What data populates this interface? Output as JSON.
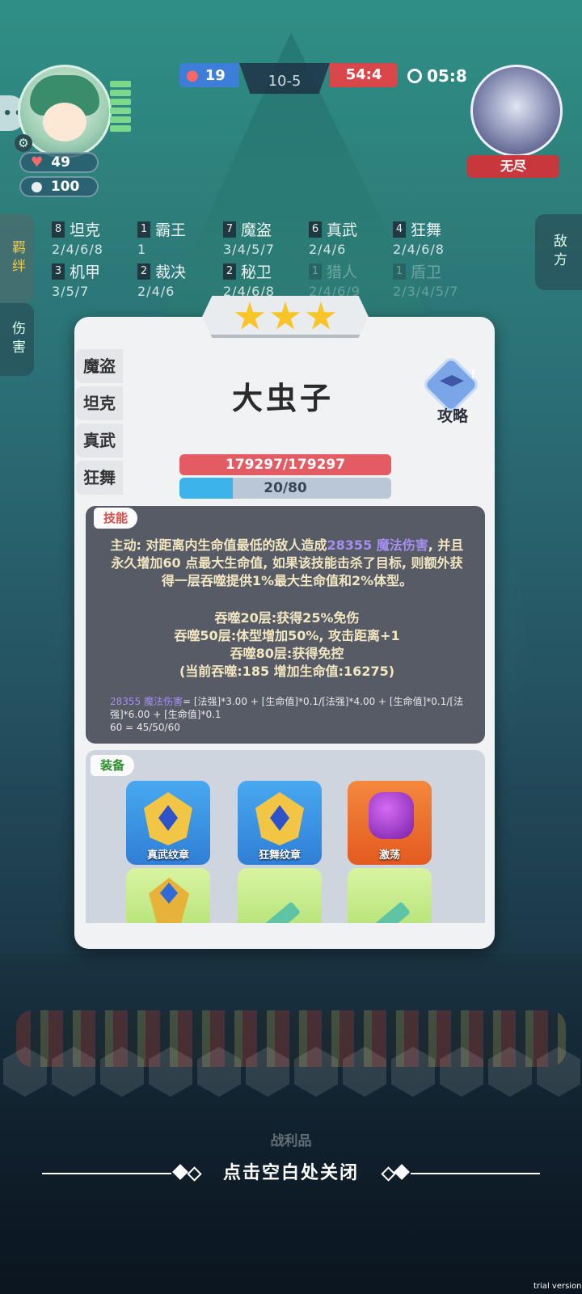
{
  "top": {
    "player_hp": "49",
    "player_coins": "100",
    "blue_score": "19",
    "round": "10-5",
    "red_score": "54:4",
    "timer": "05:8",
    "enemy_name": "无尽"
  },
  "left_tabs": {
    "bonds": "羁绊",
    "damage": "伤害"
  },
  "right_tab": "敌方",
  "synergies": [
    {
      "count": "8",
      "name": "坦克",
      "levels": "2/4/6/8"
    },
    {
      "count": "1",
      "name": "霸王",
      "levels": "1"
    },
    {
      "count": "7",
      "name": "魔盗",
      "levels": "3/4/5/7"
    },
    {
      "count": "6",
      "name": "真武",
      "levels": "2/4/6"
    },
    {
      "count": "4",
      "name": "狂舞",
      "levels": "2/4/6/8"
    },
    {
      "count": "3",
      "name": "机甲",
      "levels": "3/5/7"
    },
    {
      "count": "2",
      "name": "裁决",
      "levels": "2/4/6"
    },
    {
      "count": "2",
      "name": "秘卫",
      "levels": "2/4/6/8"
    },
    {
      "count": "1",
      "name": "猎人",
      "levels": "2/4/6/9"
    },
    {
      "count": "1",
      "name": "盾卫",
      "levels": "2/3/4/5/7"
    }
  ],
  "modal": {
    "star_count": 3,
    "hero_name": "大虫子",
    "guide_label": "攻略",
    "tags": [
      "魔盗",
      "坦克",
      "真武",
      "狂舞"
    ],
    "hp_text": "179297/179297",
    "mana_text": "20/80",
    "mana_ratio": 0.25,
    "skill_tag": "技能",
    "skill_desc_1": "主动: 对距离内生命值最低的敌人造成",
    "skill_dmg": "28355 魔法伤害",
    "skill_desc_2": ", 并且永久增加60 点最大生命值, 如果该技能击杀了目标, 则额外获得一层吞噬提供1%最大生命值和2%体型。",
    "skill_lines": [
      "吞噬20层:获得25%免伤",
      "吞噬50层:体型增加50%, 攻击距离+1",
      "吞噬80层:获得免控",
      "(当前吞噬:185 增加生命值:16275)"
    ],
    "formula_head": "28355 魔法伤害",
    "formula_body": "= [法强]*3.00 + [生命值]*0.1/[法强]*4.00 + [生命值]*0.1/[法强]*6.00 + [生命值]*0.1",
    "formula_line2": "60 = 45/50/60",
    "equip_tag": "装备",
    "items": [
      {
        "label": "真武纹章",
        "color": "blue"
      },
      {
        "label": "狂舞纹章",
        "color": "blue"
      },
      {
        "label": "激荡",
        "color": "orange"
      },
      {
        "label": "",
        "color": "green"
      },
      {
        "label": "",
        "color": "green"
      },
      {
        "label": "",
        "color": "green"
      }
    ]
  },
  "bottom": {
    "loot_label": "战利品",
    "close_hint": "点击空白处关闭",
    "trial_label": "trial version"
  }
}
